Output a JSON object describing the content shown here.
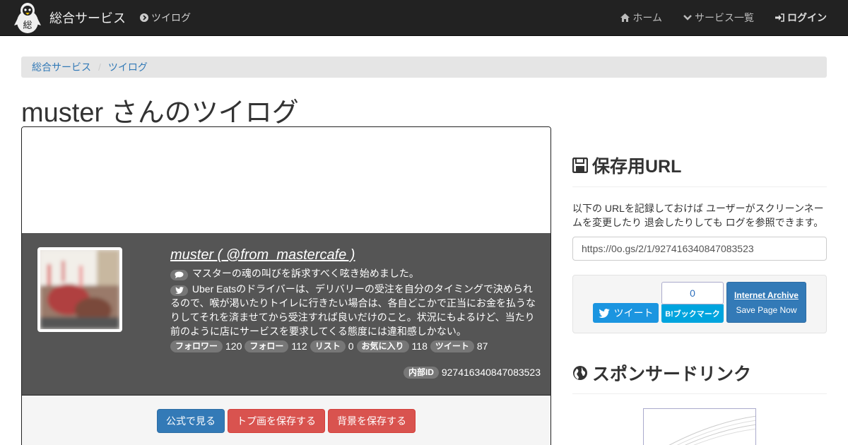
{
  "navbar": {
    "brand": "総合サービス",
    "logo_text": "総",
    "section": "ツイログ",
    "home": "ホーム",
    "services": "サービス一覧",
    "login": "ログイン"
  },
  "breadcrumb": [
    "総合サービス",
    "ツイログ"
  ],
  "page_title": "muster さんのツイログ",
  "profile": {
    "name": "muster ( @from_mastercafe )",
    "bio": "マスターの魂の叫びを訴求すべく呟き始めました。",
    "latest_tweet": "Uber Eatsのドライバーは、デリバリーの受注を自分のタイミングで決められるので、喉が渇いたりトイレに行きたい場合は、各自どこかで正当にお金を払うなりしてそれを済ませてから受注すれば良いだけのこと。状況にもよるけど、当たり前のように店にサービスを要求してくる態度には違和感しかない。",
    "stats": [
      {
        "label": "フォロワー",
        "value": "120"
      },
      {
        "label": "フォロー",
        "value": "112"
      },
      {
        "label": "リスト",
        "value": "0"
      },
      {
        "label": "お気に入り",
        "value": "118"
      },
      {
        "label": "ツイート",
        "value": "87"
      }
    ],
    "internal_id_label": "内部ID",
    "internal_id": "927416340847083523"
  },
  "actions": {
    "view_official": "公式で見る",
    "save_top_image": "トプ画を保存する",
    "save_background": "背景を保存する"
  },
  "sidebar": {
    "save_url_heading": "保存用URL",
    "save_url_desc": "以下の URLを記録しておけば ユーザーがスクリーンネームを変更したり 退会したりしても ログを参照できます。",
    "save_url_value": "https://0o.gs/2/1/927416340847083523",
    "tweet_button": "ツイート",
    "hatena_count": "0",
    "hatena_button": "B!ブックマーク",
    "ia_title": "Internet Archive",
    "ia_sub": "Save Page Now",
    "sponsor_heading": "スポンサードリンク"
  },
  "colors": {
    "navbar_bg": "#222222",
    "info_bg": "#555555",
    "primary": "#337ab7",
    "danger": "#d9534f",
    "twitter": "#1b95e0",
    "hatena": "#00a4de"
  }
}
